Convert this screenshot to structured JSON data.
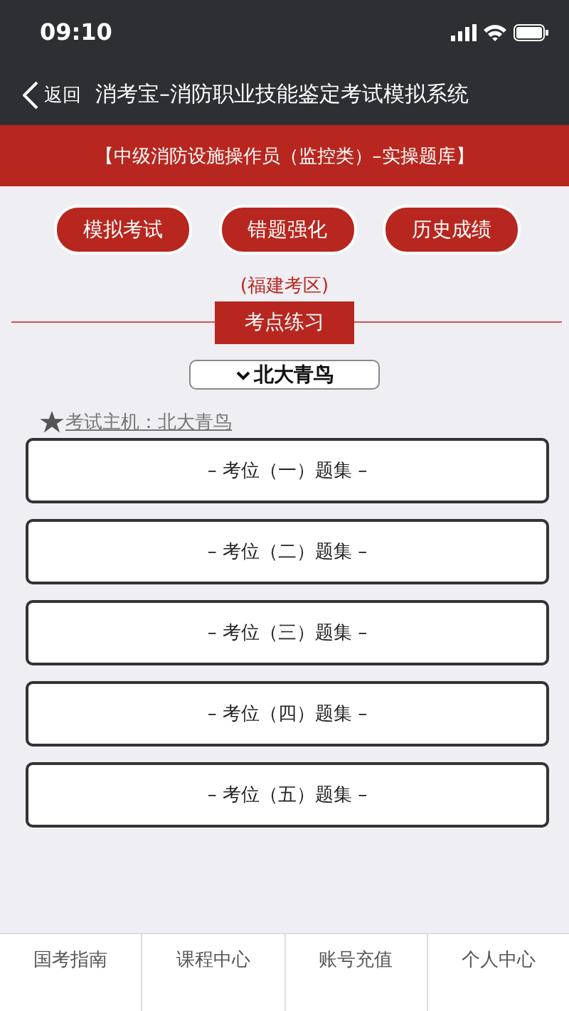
{
  "status_bar": {
    "time": "09:10"
  },
  "nav": {
    "back_label": "返回",
    "title": "消考宝–消防职业技能鉴定考试模拟系统"
  },
  "banner": "【中级消防设施操作员（监控类）–实操题库】",
  "actions": [
    "模拟考试",
    "错题强化",
    "历史成绩"
  ],
  "region": "(福建考区)",
  "section_title": "考点练习",
  "dropdown": {
    "value": "北大青鸟"
  },
  "host_label": "考试主机：北大青鸟",
  "sets": [
    "– 考位（一）题集 –",
    "– 考位（二）题集 –",
    "– 考位（三）题集 –",
    "– 考位（四）题集 –",
    "– 考位（五）题集 –"
  ],
  "tab_bar": [
    "国考指南",
    "课程中心",
    "账号充值",
    "个人中心"
  ]
}
